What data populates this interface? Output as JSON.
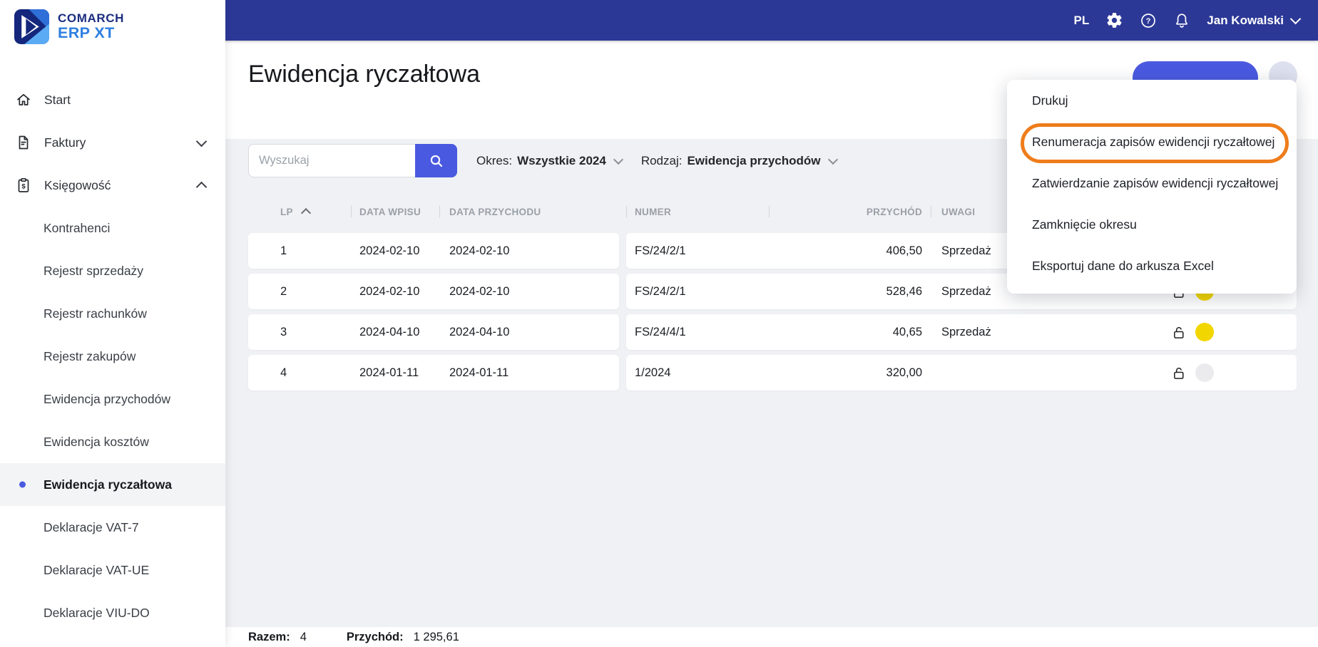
{
  "brand": {
    "line1": "COMARCH",
    "line2": "ERP XT"
  },
  "topbar": {
    "language": "PL",
    "user_name": "Jan Kowalski"
  },
  "sidebar": {
    "items": [
      {
        "label": "Start"
      },
      {
        "label": "Faktury"
      },
      {
        "label": "Księgowość"
      }
    ],
    "sub_items": [
      {
        "label": "Kontrahenci"
      },
      {
        "label": "Rejestr sprzedaży"
      },
      {
        "label": "Rejestr rachunków"
      },
      {
        "label": "Rejestr zakupów"
      },
      {
        "label": "Ewidencja przychodów"
      },
      {
        "label": "Ewidencja kosztów"
      },
      {
        "label": "Ewidencja ryczałtowa"
      },
      {
        "label": "Deklaracje VAT-7"
      },
      {
        "label": "Deklaracje VAT-UE"
      },
      {
        "label": "Deklaracje VIU-DO"
      }
    ],
    "active_item": "Ewidencja ryczałtowa"
  },
  "page": {
    "title": "Ewidencja ryczałtowa"
  },
  "search": {
    "placeholder": "Wyszukaj"
  },
  "filters": {
    "okres_label": "Okres:",
    "okres_value": "Wszystkie 2024",
    "rodzaj_label": "Rodzaj:",
    "rodzaj_value": "Ewidencja przychodów"
  },
  "table": {
    "headers": {
      "lp": "LP",
      "data_wpisu": "DATA WPISU",
      "data_przychodu": "DATA PRZYCHODU",
      "numer": "NUMER",
      "przychod": "PRZYCHÓD",
      "uwagi": "UWAGI"
    },
    "rows": [
      {
        "lp": "1",
        "data_wpisu": "2024-02-10",
        "data_przychodu": "2024-02-10",
        "numer": "FS/24/2/1",
        "przychod": "406,50",
        "uwagi": "Sprzedaż",
        "dot_color": "#f2d600"
      },
      {
        "lp": "2",
        "data_wpisu": "2024-02-10",
        "data_przychodu": "2024-02-10",
        "numer": "FS/24/2/1",
        "przychod": "528,46",
        "uwagi": "Sprzedaż",
        "dot_color": "#f2d600"
      },
      {
        "lp": "3",
        "data_wpisu": "2024-04-10",
        "data_przychodu": "2024-04-10",
        "numer": "FS/24/4/1",
        "przychod": "40,65",
        "uwagi": "Sprzedaż",
        "dot_color": "#f2d600"
      },
      {
        "lp": "4",
        "data_wpisu": "2024-01-11",
        "data_przychodu": "2024-01-11",
        "numer": "1/2024",
        "przychod": "320,00",
        "uwagi": "",
        "dot_color": "#ebebed"
      }
    ]
  },
  "menu": {
    "items": [
      {
        "label": "Drukuj"
      },
      {
        "label": "Renumeracja zapisów ewidencji ryczałtowej",
        "highlighted": true
      },
      {
        "label": "Zatwierdzanie zapisów ewidencji ryczałtowej"
      },
      {
        "label": "Zamknięcie okresu"
      },
      {
        "label": "Eksportuj dane do arkusza Excel"
      }
    ]
  },
  "summary": {
    "razem_label": "Razem:",
    "razem_value": "4",
    "przychod_label": "Przychód:",
    "przychod_value": "1 295,61"
  },
  "colors": {
    "accent": "#4a5ae0",
    "topbar": "#2c3896",
    "status_yellow": "#f2d600",
    "status_gray": "#ebebed",
    "annotation_orange": "#ee7d1b"
  }
}
